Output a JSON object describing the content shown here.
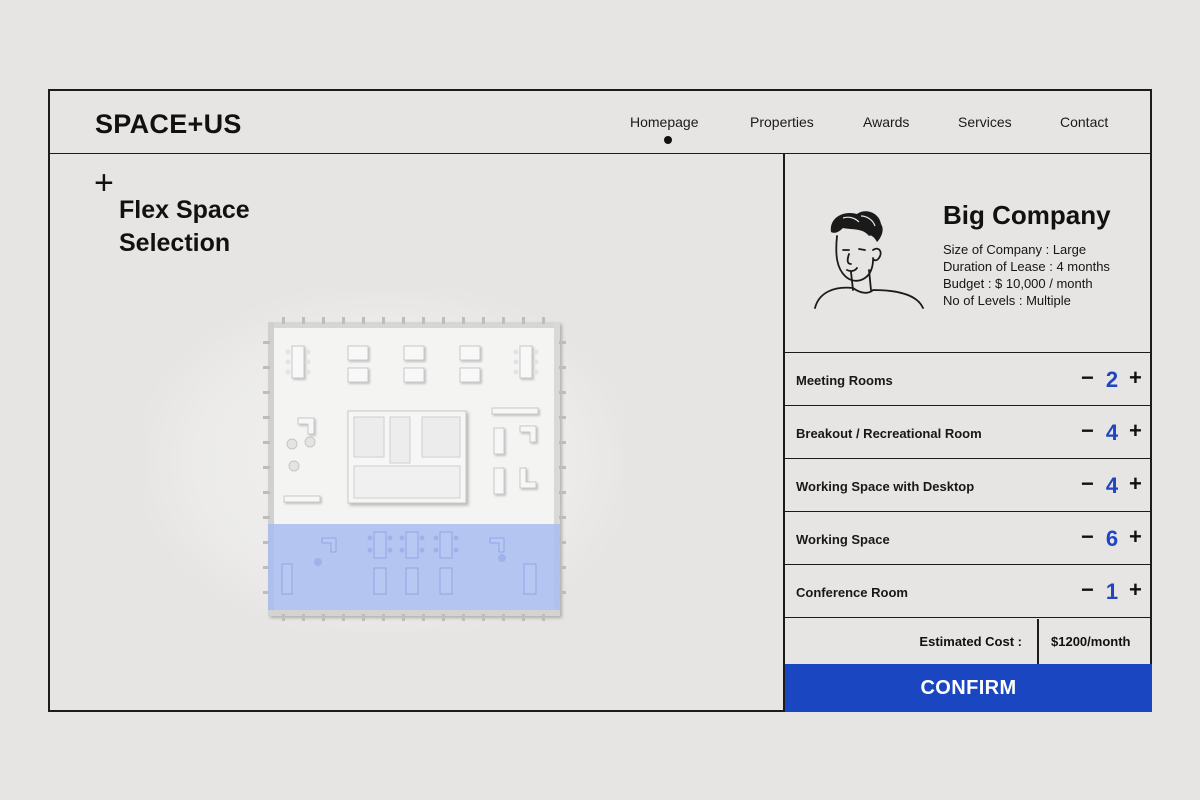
{
  "brand": {
    "logo": "SPACE+US"
  },
  "nav": {
    "items": [
      "Homepage",
      "Properties",
      "Awards",
      "Services",
      "Contact"
    ],
    "active": "Homepage"
  },
  "left": {
    "plus_icon": "+",
    "title_line1": "Flex Space",
    "title_line2": "Selection"
  },
  "profile": {
    "company": "Big Company",
    "details": [
      "Size of Company : Large",
      "Duration of Lease : 4 months",
      "Budget : $ 10,000 / month",
      "No of Levels : Multiple"
    ]
  },
  "rooms": [
    {
      "label": "Meeting Rooms",
      "count": "2"
    },
    {
      "label": "Breakout / Recreational Room",
      "count": "4"
    },
    {
      "label": "Working Space with Desktop",
      "count": "4"
    },
    {
      "label": "Working Space",
      "count": "6"
    },
    {
      "label": "Conference Room",
      "count": "1"
    }
  ],
  "stepper": {
    "minus": "−",
    "plus": "+"
  },
  "cost": {
    "label": "Estimated Cost :",
    "value": "$1200/month"
  },
  "confirm_label": "CONFIRM",
  "colors": {
    "accent": "#1b46c2",
    "count": "#1f45c0",
    "highlight": "#a9bcf0",
    "border": "#1c1c1c",
    "background": "#e6e5e3"
  },
  "icons": {
    "avatar": "person-avatar-icon",
    "floorplan": "floor-plan-icon",
    "plus_mark": "plus-icon"
  }
}
